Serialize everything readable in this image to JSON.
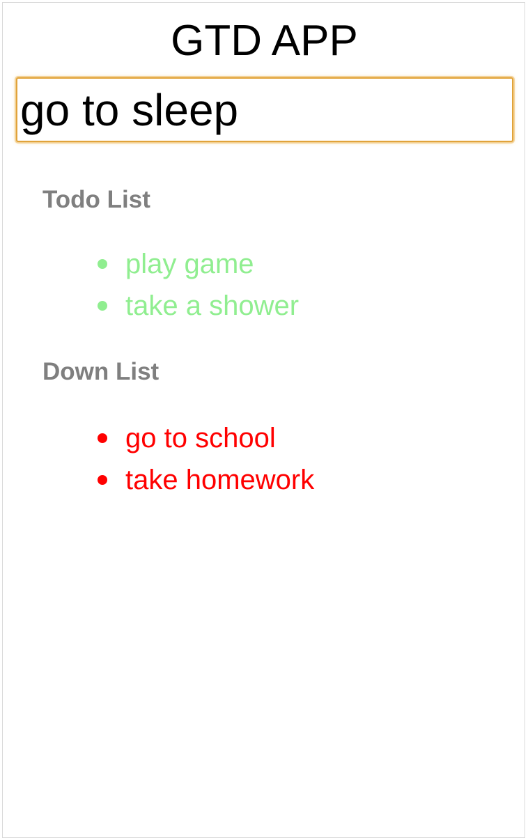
{
  "app": {
    "title": "GTD APP"
  },
  "input": {
    "value": "go to sleep",
    "focus_color": "#e1a33a"
  },
  "todo": {
    "heading": "Todo List",
    "color": "#90ee90",
    "items": [
      {
        "label": "play game"
      },
      {
        "label": "take a shower"
      }
    ]
  },
  "done": {
    "heading": "Down List",
    "color": "#ff0000",
    "items": [
      {
        "label": "go to school"
      },
      {
        "label": "take homework"
      }
    ]
  }
}
